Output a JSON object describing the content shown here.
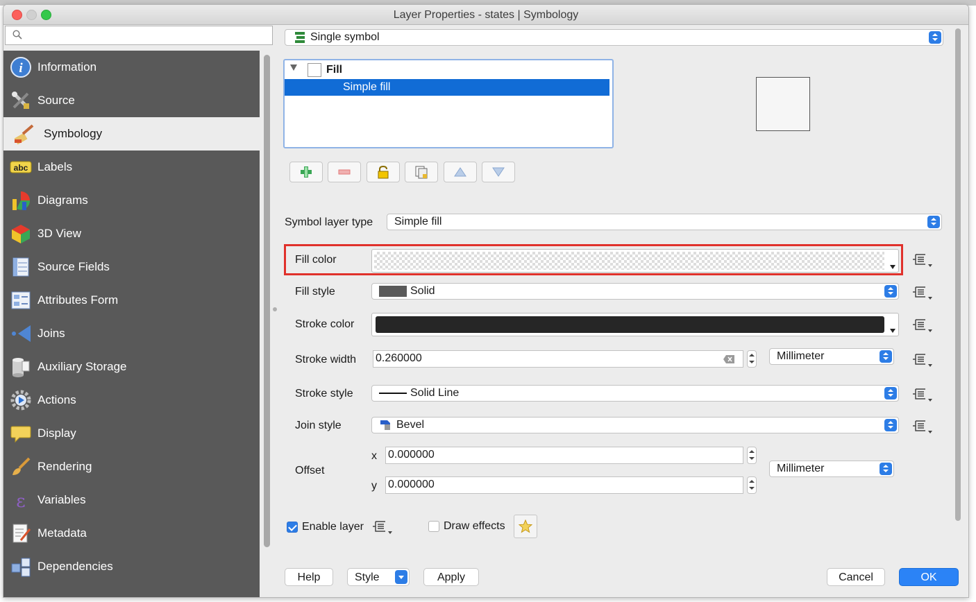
{
  "window": {
    "title": "Layer Properties - states | Symbology"
  },
  "search": {
    "placeholder": ""
  },
  "sidebar": {
    "items": [
      {
        "label": "Information",
        "icon": "info-icon"
      },
      {
        "label": "Source",
        "icon": "source-tools-icon"
      },
      {
        "label": "Symbology",
        "icon": "symbology-brush-icon",
        "active": true
      },
      {
        "label": "Labels",
        "icon": "labels-abc-icon"
      },
      {
        "label": "Diagrams",
        "icon": "diagrams-icon"
      },
      {
        "label": "3D View",
        "icon": "cube-3d-icon"
      },
      {
        "label": "Source Fields",
        "icon": "source-fields-icon"
      },
      {
        "label": "Attributes Form",
        "icon": "attributes-form-icon"
      },
      {
        "label": "Joins",
        "icon": "joins-icon"
      },
      {
        "label": "Auxiliary Storage",
        "icon": "database-icon"
      },
      {
        "label": "Actions",
        "icon": "actions-gear-icon"
      },
      {
        "label": "Display",
        "icon": "speech-bubble-icon"
      },
      {
        "label": "Rendering",
        "icon": "rendering-brush-icon"
      },
      {
        "label": "Variables",
        "icon": "epsilon-icon"
      },
      {
        "label": "Metadata",
        "icon": "metadata-icon"
      },
      {
        "label": "Dependencies",
        "icon": "dependencies-icon"
      }
    ]
  },
  "renderer": {
    "type_label": "Single symbol"
  },
  "symbol_tree": {
    "root_label": "Fill",
    "child_label": "Simple fill"
  },
  "layer_toolbar": {
    "buttons": [
      "add-layer-icon",
      "remove-layer-icon",
      "lock-icon",
      "duplicate-icon",
      "move-up-icon",
      "move-down-icon"
    ]
  },
  "symbol_layer_type": {
    "label": "Symbol layer type",
    "value": "Simple fill"
  },
  "properties": {
    "fill_color_label": "Fill color",
    "fill_style_label": "Fill style",
    "fill_style_value": "Solid",
    "stroke_color_label": "Stroke color",
    "stroke_width_label": "Stroke width",
    "stroke_width_value": "0.260000",
    "stroke_width_unit": "Millimeter",
    "stroke_style_label": "Stroke style",
    "stroke_style_value": "Solid Line",
    "join_style_label": "Join style",
    "join_style_value": "Bevel",
    "offset_label": "Offset",
    "offset_x_label": "x",
    "offset_x_value": "0.000000",
    "offset_y_label": "y",
    "offset_y_value": "0.000000",
    "offset_unit": "Millimeter"
  },
  "options": {
    "enable_layer_label": "Enable layer",
    "enable_layer_checked": true,
    "draw_effects_label": "Draw effects",
    "draw_effects_checked": false
  },
  "footer": {
    "help": "Help",
    "style": "Style",
    "apply": "Apply",
    "cancel": "Cancel",
    "ok": "OK"
  },
  "colors": {
    "accent": "#2d7de6",
    "selection": "#116cd6",
    "highlight_border": "#e0312b",
    "sidebar_bg": "#595959",
    "stroke_color": "#262626"
  }
}
